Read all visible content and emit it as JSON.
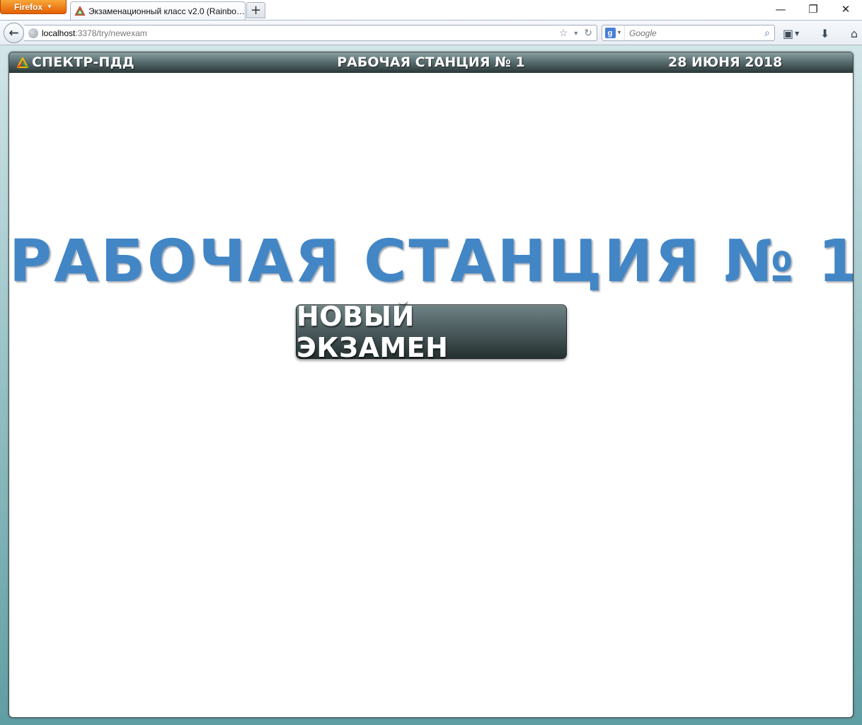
{
  "browser": {
    "menu_button_label": "Firefox",
    "tab_title": "Экзаменационный класс v2.0 (Rainbow...",
    "new_tab_label": "+",
    "url_host": "localhost",
    "url_rest": ":3378/try/newexam",
    "search_placeholder": "Google",
    "window_controls": {
      "minimize": "—",
      "restore": "❐",
      "close": "✕"
    }
  },
  "app": {
    "brand": "СПЕКТР-ПДД",
    "station_header": "РАБОЧАЯ СТАНЦИЯ № 1",
    "date": "28 ИЮНЯ 2018",
    "big_title": "РАБОЧАЯ СТАНЦИЯ № 1",
    "new_exam_button": "НОВЫЙ ЭКЗАМЕН"
  },
  "colors": {
    "title_blue": "#4286c5",
    "header_dark": "#2a3638",
    "background_teal": "#5f9ea3",
    "firefox_orange": "#e66000"
  },
  "icons": [
    "firefox-menu-caret-icon",
    "tab-favicon-icon",
    "back-arrow-icon",
    "globe-icon",
    "bookmark-star-icon",
    "dropdown-arrow-icon",
    "reload-icon",
    "google-icon",
    "search-magnifier-icon",
    "bookmarks-menu-icon",
    "download-icon",
    "home-icon",
    "app-logo-icon"
  ]
}
